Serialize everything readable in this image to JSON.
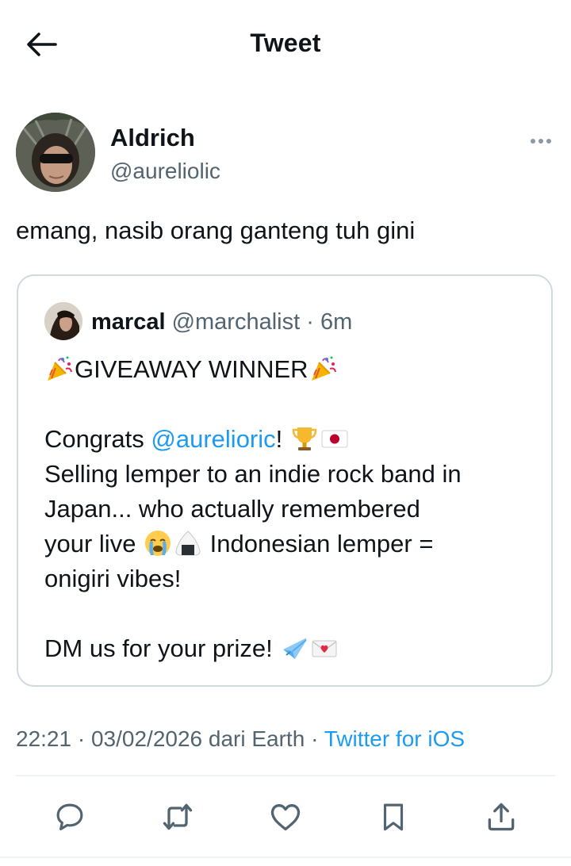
{
  "header": {
    "title": "Tweet"
  },
  "author": {
    "name": "Aldrich",
    "handle": "@aureliolic"
  },
  "tweet": {
    "text": "emang, nasib orang ganteng tuh gini"
  },
  "quote": {
    "name": "marcal",
    "handle": "@marchalist",
    "separator": "·",
    "time": "6m",
    "line1": "GIVEAWAY WINNER",
    "congrats_prefix": "Congrats ",
    "mention": "@aurelioric",
    "congrats_suffix": "!",
    "line3": "Selling lemper to an indie rock band in",
    "line4": "Japan... who actually remembered",
    "line5_prefix": "your live ",
    "line5_suffix": " Indonesian lemper =",
    "line6": "onigiri vibes!",
    "line8": "DM us for your prize! "
  },
  "meta": {
    "time": "22:21",
    "dot1": "·",
    "date": "03/02/2026",
    "location": "dari Earth",
    "dot2": "·",
    "source": "Twitter for iOS"
  },
  "icons": {
    "back": "arrow-left-icon",
    "more": "more-horizontal-icon",
    "reply": "reply-icon",
    "retweet": "retweet-icon",
    "like": "heart-icon",
    "bookmark": "bookmark-icon",
    "share": "share-icon",
    "emojis": [
      "party-popper",
      "trophy",
      "japan-flag",
      "crying-face",
      "rice-ball",
      "airplane",
      "love-letter"
    ]
  },
  "colors": {
    "accent": "#1d9bf0",
    "text": "#0f1419",
    "secondary": "#536471",
    "border": "#cfd9de"
  }
}
